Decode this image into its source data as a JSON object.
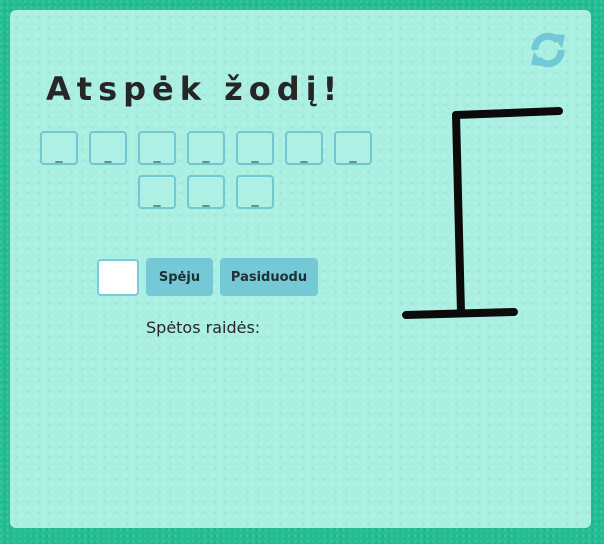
{
  "title": "Atspėk žodį!",
  "word_slots": [
    "_",
    "_",
    "_",
    "_",
    "_",
    "_",
    "_",
    "_",
    "_",
    "_"
  ],
  "guess_input": {
    "value": "",
    "placeholder": ""
  },
  "buttons": {
    "guess": "Spėju",
    "give_up": "Pasiduodu"
  },
  "guessed_letters_label": "Spėtos raidės:",
  "guessed_letters": "",
  "icons": {
    "refresh": "refresh-icon"
  },
  "colors": {
    "background": "#23bd93",
    "panel": "#a9efe2",
    "slot_border": "#73c6d3",
    "button": "#75c8d5",
    "icon": "#70c9d5",
    "gallows": "#0b0b0b"
  }
}
